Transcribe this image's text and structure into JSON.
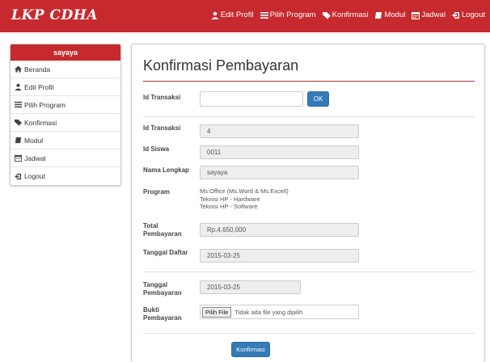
{
  "navbar": {
    "brand": "LKP CDHA",
    "items": [
      {
        "label": "Edit Profil",
        "icon": "user-icon"
      },
      {
        "label": "Pilih Program",
        "icon": "list-icon"
      },
      {
        "label": "Konfirmasi",
        "icon": "tags-icon"
      },
      {
        "label": "Modul",
        "icon": "book-icon"
      },
      {
        "label": "Jadwal",
        "icon": "calendar-icon"
      },
      {
        "label": "Logout",
        "icon": "logout-icon"
      }
    ]
  },
  "sidebar": {
    "user": "sayaya",
    "items": [
      {
        "label": "Beranda",
        "icon": "home-icon"
      },
      {
        "label": "Edit Profil",
        "icon": "user-icon"
      },
      {
        "label": "Pilih Program",
        "icon": "list-icon"
      },
      {
        "label": "Konfirmasi",
        "icon": "tags-icon"
      },
      {
        "label": "Modul",
        "icon": "book-icon"
      },
      {
        "label": "Jadwal",
        "icon": "calendar-icon"
      },
      {
        "label": "Logout",
        "icon": "logout-icon"
      }
    ]
  },
  "main": {
    "title": "Konfirmasi Pembayaran",
    "search": {
      "label": "Id Transaksi",
      "value": "",
      "button": "OK"
    },
    "details": {
      "id_transaksi_label": "Id Transaksi",
      "id_transaksi": "4",
      "id_siswa_label": "Id Siswa",
      "id_siswa": "0011",
      "nama_label": "Nama Lengkap",
      "nama": "sayaya",
      "program_label": "Program",
      "programs": [
        "Ms.Office (Ms.Word & Ms.Excell)",
        "Teknisi HP - Hardware",
        "Teknisi HP - Software"
      ],
      "total_label": "Total Pembayaran",
      "total": "Rp.4,650,000",
      "tanggal_daftar_label": "Tanggal Daftar",
      "tanggal_daftar": "2015-03-25"
    },
    "payment": {
      "tanggal_label": "Tanggal Pembayaran",
      "tanggal": "2015-03-25",
      "bukti_label": "Bukti Pembayaran",
      "file_button": "Pilih File",
      "file_text": "Tidak ada file yang dipilih",
      "submit": "Konfirmasi"
    }
  },
  "colors": {
    "brand": "#c62a2e",
    "primary": "#337ab7"
  }
}
